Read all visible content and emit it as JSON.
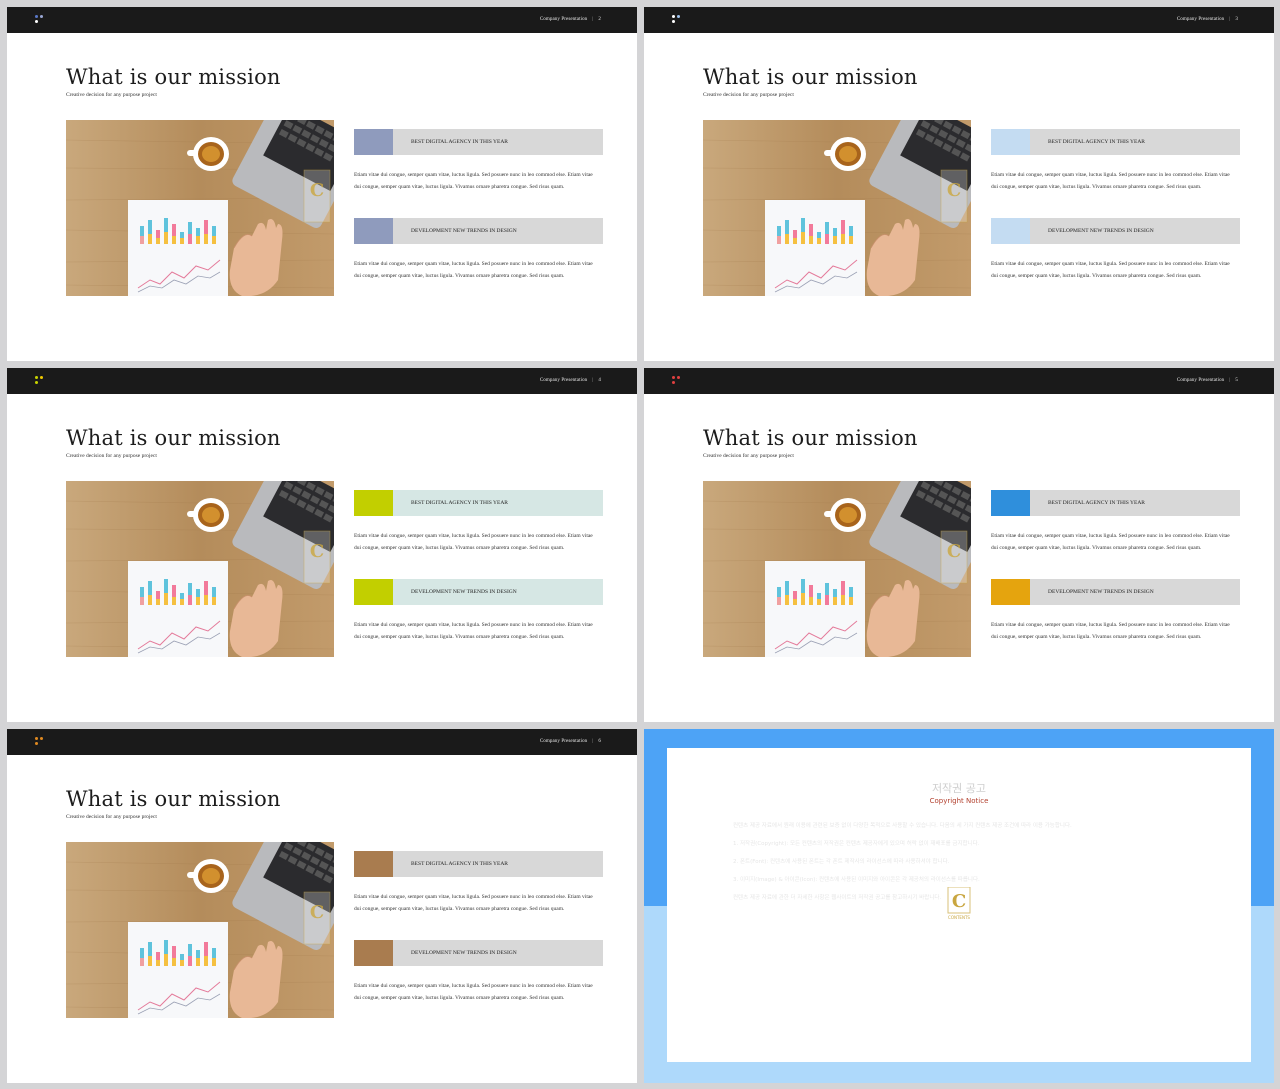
{
  "slides": [
    {
      "meta": "Company Presentation",
      "page": "2",
      "title": "What is our mission",
      "subtitle": "Creative decision for any purpose  project",
      "accent": "#8f9bbd",
      "head_bg": "#d8d8d8",
      "dot_colors": [
        "#5a78c8",
        "#9aa7d4",
        "#ffffff"
      ],
      "blocks": [
        {
          "label": "BEST  DIGITAL AGENCY  IN THIS YEAR",
          "text": "Etiam vitae dui congue,  semper  quam vitae,  luctus ligula.  Sed posuere  nunc in leo commod else. Etiam vitae dui congue,  semper  quam vitae,  luctus ligula.  Vivamus ornare pharetra congue.  Sed risus quam."
        },
        {
          "label": "DEVELOPMENT  NEW  TRENDS  IN DESIGN",
          "text": "Etiam vitae dui congue,  semper  quam vitae,  luctus ligula.  Sed posuere  nunc in leo commod else. Etiam vitae dui congue,  semper  quam vitae,  luctus ligula.  Vivamus ornare pharetra congue.  Sed risus quam."
        }
      ]
    },
    {
      "meta": "Company Presentation",
      "page": "3",
      "title": "What is our mission",
      "subtitle": "Creative decision for any purpose  project",
      "accent": "#c4dcf2",
      "head_bg": "#d8d8d8",
      "dot_colors": [
        "#ffffff",
        "#9fc3ee",
        "#ffffff"
      ],
      "blocks": [
        {
          "label": "BEST  DIGITAL AGENCY  IN THIS YEAR",
          "text": "Etiam vitae dui congue,  semper  quam vitae,  luctus ligula.  Sed posuere  nunc in leo commod else. Etiam vitae dui congue,  semper  quam vitae,  luctus ligula.  Vivamus ornare pharetra congue.  Sed risus quam."
        },
        {
          "label": "DEVELOPMENT  NEW  TRENDS  IN DESIGN",
          "text": "Etiam vitae dui congue,  semper  quam vitae,  luctus ligula.  Sed posuere  nunc in leo commod else. Etiam vitae dui congue,  semper  quam vitae,  luctus ligula.  Vivamus ornare pharetra congue.  Sed risus quam."
        }
      ]
    },
    {
      "meta": "Company Presentation",
      "page": "4",
      "title": "What is our mission",
      "subtitle": "Creative decision for any purpose  project",
      "accent": "#c2cf00",
      "head_bg": "#d6e7e4",
      "dot_colors": [
        "#c8d400",
        "#f0c800",
        "#c8d400"
      ],
      "blocks": [
        {
          "label": "BEST  DIGITAL AGENCY  IN THIS YEAR",
          "text": "Etiam vitae dui congue,  semper  quam vitae,  luctus ligula.  Sed posuere  nunc in leo commod else. Etiam vitae dui congue,  semper  quam vitae,  luctus ligula.  Vivamus ornare pharetra congue.  Sed risus quam."
        },
        {
          "label": "DEVELOPMENT  NEW  TRENDS  IN DESIGN",
          "text": "Etiam vitae dui congue,  semper  quam vitae,  luctus ligula.  Sed posuere  nunc in leo commod else. Etiam vitae dui congue,  semper  quam vitae,  luctus ligula.  Vivamus ornare pharetra congue.  Sed risus quam."
        }
      ]
    },
    {
      "meta": "Company Presentation",
      "page": "5",
      "title": "What is our mission",
      "subtitle": "Creative decision for any purpose  project",
      "accent": "#2f8fdc",
      "accent2": "#e5a40e",
      "head_bg": "#d8d8d8",
      "dot_colors": [
        "#e04040",
        "#e04040",
        "#e04040"
      ],
      "blocks": [
        {
          "label": "BEST  DIGITAL AGENCY  IN THIS YEAR",
          "text": "Etiam vitae dui congue,  semper  quam vitae,  luctus ligula.  Sed posuere  nunc in leo commod else. Etiam vitae dui congue,  semper  quam vitae,  luctus ligula.  Vivamus ornare pharetra congue.  Sed risus quam."
        },
        {
          "label": "DEVELOPMENT  NEW  TRENDS  IN DESIGN",
          "text": "Etiam vitae dui congue,  semper  quam vitae,  luctus ligula.  Sed posuere  nunc in leo commod else. Etiam vitae dui congue,  semper  quam vitae,  luctus ligula.  Vivamus ornare pharetra congue.  Sed risus quam."
        }
      ]
    },
    {
      "meta": "Company Presentation",
      "page": "6",
      "title": "What is our mission",
      "subtitle": "Creative decision for any purpose  project",
      "accent": "#a97c4f",
      "head_bg": "#d8d8d8",
      "dot_colors": [
        "#e08a20",
        "#e08a20",
        "#e08a20"
      ],
      "blocks": [
        {
          "label": "BEST  DIGITAL AGENCY  IN THIS YEAR",
          "text": "Etiam vitae dui congue,  semper  quam vitae,  luctus ligula.  Sed posuere  nunc in leo commod else. Etiam vitae dui congue,  semper  quam vitae,  luctus ligula.  Vivamus ornare pharetra congue.  Sed risus quam."
        },
        {
          "label": "DEVELOPMENT  NEW  TRENDS  IN DESIGN",
          "text": "Etiam vitae dui congue,  semper  quam vitae,  luctus ligula.  Sed posuere  nunc in leo commod else. Etiam vitae dui congue,  semper  quam vitae,  luctus ligula.  Vivamus ornare pharetra congue.  Sed risus quam."
        }
      ]
    }
  ],
  "copyright": {
    "title": "저작권 공고",
    "subtitle": "Copyright Notice",
    "bg_top": "#4da3f6",
    "bg_bottom": "#aed9fb",
    "logo_letter": "C",
    "logo_text": "CONTENTS",
    "paragraphs": [
      "컨텐츠 제공 자료에서 원래 이용에 관련된 보증 없이 다양한 목적으로 사용할 수 있습니다. 다음의 세 가지 컨텐츠 제공 조건에 따라 이용 가능합니다.",
      "1. 저작권(Copyright): 모든 컨텐츠의 저작권은 컨텐츠 제공자에게 있으며 허락 없이 재배포를 금지합니다.",
      "2. 폰트(Font): 컨텐츠에 사용된 폰트는 각 폰트 제작사의 라이선스에 따라 사용하셔야 합니다.",
      "3. 이미지(Image) & 아이콘(Icon): 컨텐츠에 사용된 이미지와 아이콘은 각 제공처의 라이선스를 따릅니다.",
      "컨텐츠 제공 자료에 관한 더 자세한 사항은 웹사이트의 저작권 공고를 참고하시기 바랍니다."
    ]
  }
}
